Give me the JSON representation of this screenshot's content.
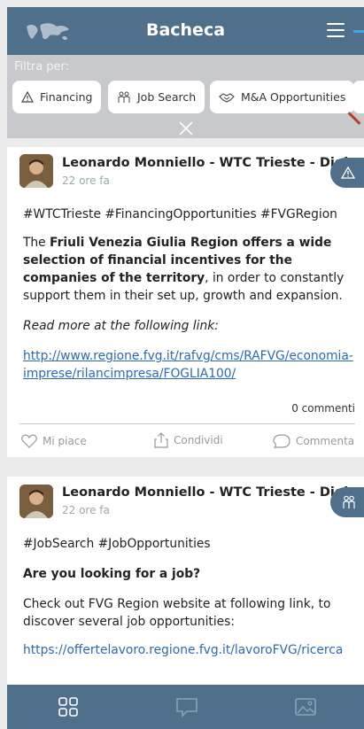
{
  "header": {
    "title": "Bacheca",
    "logo_icon": "world-map-icon",
    "menu_icon": "hamburger-icon"
  },
  "filter": {
    "label": "Filtra per:",
    "chips": [
      {
        "label": "Financing",
        "icon": "warning-triangle-icon"
      },
      {
        "label": "Job Search",
        "icon": "people-icon"
      },
      {
        "label": "M&A Opportunities",
        "icon": "handshake-icon"
      }
    ],
    "close_icon": "close-icon"
  },
  "posts": [
    {
      "author": "Leonardo Monniello - WTC Trieste - Digita...",
      "time": "22 ore fa",
      "tags": "#WTCTrieste #FinancingOpportunities #FVGRegion",
      "body_pre": "The ",
      "body_bold": "Friuli Venezia Giulia Region offers a wide selection of financial incentives for the companies of the territory",
      "body_post": ", in order to constantly support them in their set up, growth and expansion.",
      "read_more": "Read more at the following link:",
      "link": "http://www.regione.fvg.it/rafvg/cms/RAFVG/economia-imprese/rilancimpresa/FOGLIA100/",
      "comments": "0 commenti",
      "actions": {
        "like": "Mi piace",
        "share": "Condividi",
        "comment": "Commenta"
      }
    },
    {
      "author": "Leonardo Monniello - WTC Trieste - Digita...",
      "time": "22 ore fa",
      "tags": "#JobSearch #JobOpportunities",
      "headline": "Are you looking for a job?",
      "body": "Check out FVG Region website at following link, to discover several job opportunities:",
      "link": "https://offertelavoro.regione.fvg.it/lavoroFVG/ricerca"
    }
  ],
  "colors": {
    "primary": "#4f6f8a",
    "filter_bg": "#c7c9cd",
    "link": "#2a6ab8"
  }
}
